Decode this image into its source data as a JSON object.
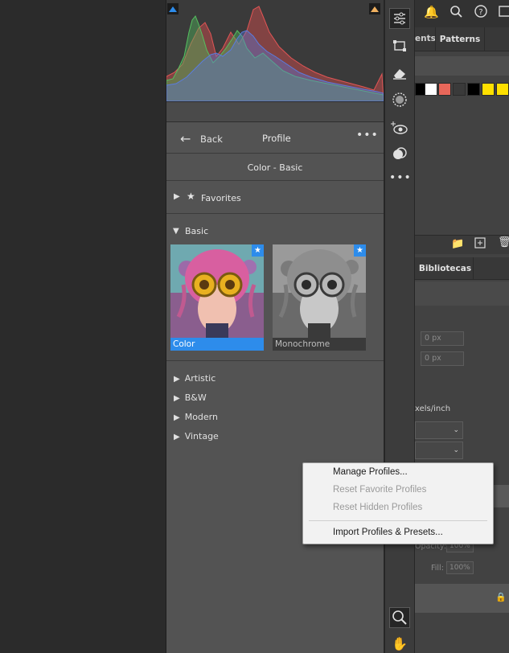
{
  "profile_panel": {
    "back_label": "Back",
    "title": "Profile",
    "more_label": "•••",
    "current_profile": "Color - Basic",
    "favorites_label": "Favorites",
    "basic_label": "Basic",
    "thumbnails": [
      {
        "label": "Color",
        "selected": true,
        "favorite": true
      },
      {
        "label": "Monochrome",
        "selected": false,
        "favorite": true
      }
    ],
    "groups": [
      "Artistic",
      "B&W",
      "Modern",
      "Vintage"
    ]
  },
  "toolbar": {
    "tools": [
      "edit-sliders",
      "crop",
      "eraser",
      "masking",
      "red-eye",
      "presets",
      "more"
    ],
    "bottom_tools": [
      "zoom",
      "hand"
    ]
  },
  "right_panel": {
    "tab_partial": "ents",
    "tab_patterns": "Patterns",
    "tab_libraries": "Bibliotecas",
    "px_value_1": "0 px",
    "px_value_2": "0 px",
    "resolution_unit": "xels/inch",
    "opacity_label": "Opacity:",
    "opacity_value": "100%",
    "fill_label": "Fill:",
    "fill_value": "100%",
    "swatch_colors": [
      "#000000",
      "#ffffff",
      "#e8675a",
      "#3a3a3a",
      "#000000",
      "#ffe000",
      "#ffe000"
    ]
  },
  "context_menu": {
    "items": [
      {
        "label": "Manage Profiles...",
        "enabled": true
      },
      {
        "label": "Reset Favorite Profiles",
        "enabled": false
      },
      {
        "label": "Reset Hidden Profiles",
        "enabled": false
      },
      {
        "label": "Import Profiles & Presets...",
        "enabled": true
      }
    ]
  },
  "colors": {
    "accent": "#2d8ceb",
    "panel_bg": "#535353",
    "menu_bg": "#f2f2f2"
  }
}
